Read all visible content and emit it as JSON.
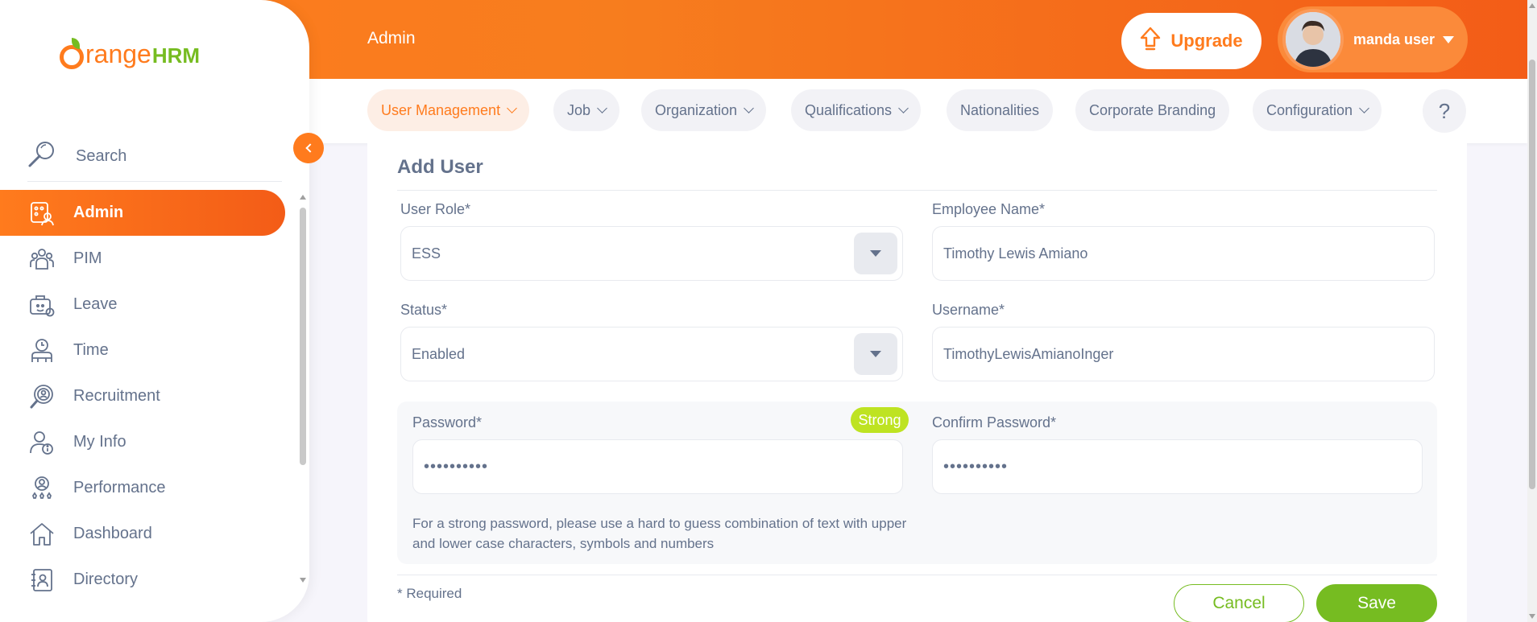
{
  "header": {
    "title": "Admin",
    "upgrade_label": "Upgrade",
    "user_name": "manda user"
  },
  "brand": {
    "logo_main": "range",
    "logo_suffix": "HRM"
  },
  "subnav": {
    "items": [
      {
        "label": "User Management",
        "has_dropdown": true,
        "active": true
      },
      {
        "label": "Job",
        "has_dropdown": true
      },
      {
        "label": "Organization",
        "has_dropdown": true
      },
      {
        "label": "Qualifications",
        "has_dropdown": true
      },
      {
        "label": "Nationalities",
        "has_dropdown": false
      },
      {
        "label": "Corporate Branding",
        "has_dropdown": false
      },
      {
        "label": "Configuration",
        "has_dropdown": true
      }
    ],
    "help_label": "?"
  },
  "sidebar": {
    "search_label": "Search",
    "items": [
      {
        "label": "Admin",
        "icon": "admin-icon",
        "active": true
      },
      {
        "label": "PIM",
        "icon": "pim-icon"
      },
      {
        "label": "Leave",
        "icon": "leave-icon"
      },
      {
        "label": "Time",
        "icon": "time-icon"
      },
      {
        "label": "Recruitment",
        "icon": "recruitment-icon"
      },
      {
        "label": "My Info",
        "icon": "my-info-icon"
      },
      {
        "label": "Performance",
        "icon": "performance-icon"
      },
      {
        "label": "Dashboard",
        "icon": "dashboard-icon"
      },
      {
        "label": "Directory",
        "icon": "directory-icon"
      }
    ]
  },
  "form": {
    "title": "Add User",
    "user_role": {
      "label": "User Role*",
      "value": "ESS"
    },
    "employee_name": {
      "label": "Employee Name*",
      "value": "Timothy Lewis Amiano"
    },
    "status": {
      "label": "Status*",
      "value": "Enabled"
    },
    "username": {
      "label": "Username*",
      "value": "TimothyLewisAmianoInger"
    },
    "password": {
      "label": "Password*",
      "value": "••••••••••",
      "strength": "Strong"
    },
    "confirm_password": {
      "label": "Confirm Password*",
      "value": "••••••••••"
    },
    "hint": "For a strong password, please use a hard to guess combination of text with upper and lower case characters, symbols and numbers",
    "required_note": "* Required",
    "cancel_label": "Cancel",
    "save_label": "Save"
  },
  "colors": {
    "accent": "#ff7b1d",
    "success": "#76bc21",
    "strength": "#bee322",
    "text": "#64728c"
  }
}
